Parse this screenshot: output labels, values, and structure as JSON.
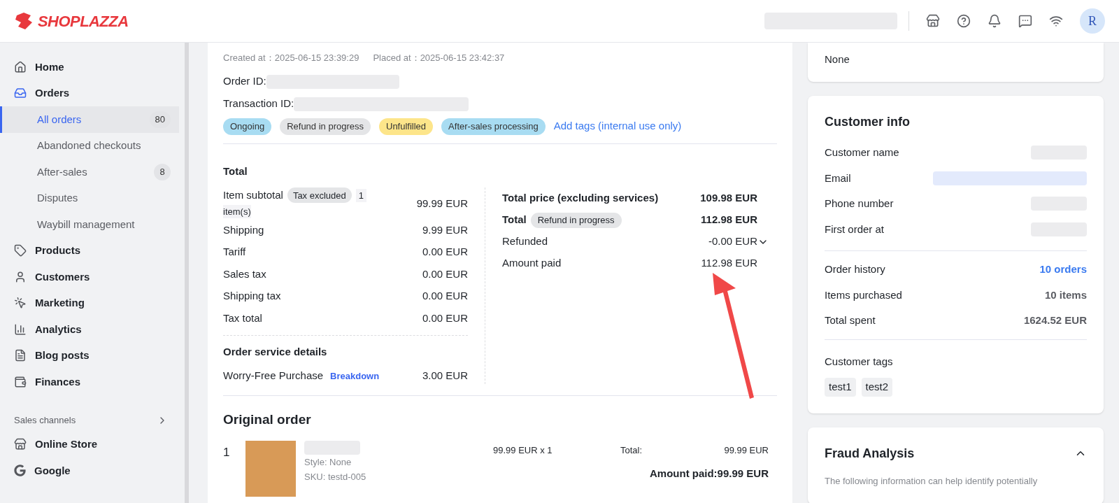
{
  "header": {
    "logo": "SHOPLAZZA",
    "avatar": "R"
  },
  "sidebar": {
    "items": [
      {
        "label": "Home",
        "kind": "nav",
        "selected": false
      },
      {
        "label": "Orders",
        "kind": "nav",
        "selected": false
      },
      {
        "label": "All orders",
        "kind": "sub",
        "selected": true,
        "badge": "80"
      },
      {
        "label": "Abandoned checkouts",
        "kind": "sub",
        "selected": false
      },
      {
        "label": "After-sales",
        "kind": "sub",
        "selected": false,
        "badge": "8"
      },
      {
        "label": "Disputes",
        "kind": "sub",
        "selected": false
      },
      {
        "label": "Waybill management",
        "kind": "sub",
        "selected": false
      },
      {
        "label": "Products",
        "kind": "nav",
        "selected": false
      },
      {
        "label": "Customers",
        "kind": "nav",
        "selected": false
      },
      {
        "label": "Marketing",
        "kind": "nav",
        "selected": false
      },
      {
        "label": "Analytics",
        "kind": "nav",
        "selected": false
      },
      {
        "label": "Blog posts",
        "kind": "nav",
        "selected": false
      },
      {
        "label": "Finances",
        "kind": "nav",
        "selected": false
      }
    ],
    "section_title": "Sales channels",
    "channels": [
      {
        "label": "Online Store"
      },
      {
        "label": "Google"
      }
    ]
  },
  "order": {
    "created_label": "Created at：",
    "created_value": "2025-06-15 23:39:29",
    "placed_label": "Placed at：",
    "placed_value": "2025-06-15 23:42:37",
    "order_id_label": "Order ID:",
    "transaction_id_label": "Transaction ID:",
    "tags": [
      {
        "label": "Ongoing",
        "color": "#a8dcf2"
      },
      {
        "label": "Refund in progress",
        "color": "#e4e5e7"
      },
      {
        "label": "Unfulfilled",
        "color": "#fde58a"
      },
      {
        "label": "After-sales processing",
        "color": "#a8dcf2"
      }
    ],
    "add_tags": "Add tags (internal use only)"
  },
  "total": {
    "title": "Total",
    "subtotal": {
      "label": "Item subtotal",
      "badge": "Tax excluded",
      "count_a": "1",
      "count_b": "item(s)",
      "value": "99.99 EUR"
    },
    "rows": [
      {
        "label": "Shipping",
        "value": "9.99 EUR"
      },
      {
        "label": "Tariff",
        "value": "0.00 EUR"
      },
      {
        "label": "Sales tax",
        "value": "0.00 EUR"
      },
      {
        "label": "Shipping tax",
        "value": "0.00 EUR"
      },
      {
        "label": "Tax total",
        "value": "0.00 EUR"
      }
    ],
    "service_title": "Order service details",
    "service": {
      "label": "Worry-Free Purchase",
      "link": "Breakdown",
      "value": "3.00 EUR"
    },
    "summary": [
      {
        "label": "Total price (excluding services)",
        "value": "109.98 EUR",
        "kind": "bold"
      },
      {
        "label": "Total",
        "badge": "Refund in progress",
        "value": "112.98 EUR",
        "kind": "bold"
      },
      {
        "label": "Refunded",
        "value": "-0.00 EUR",
        "kind": "expandable"
      },
      {
        "label": "Amount paid",
        "value": "112.98 EUR",
        "kind": "plain"
      }
    ]
  },
  "original_order": {
    "title": "Original order",
    "line": {
      "index": "1",
      "style": "Style: None",
      "sku": "SKU: testd-005",
      "price": "99.99 EUR x 1",
      "total_label": "Total:",
      "total_value": "99.99 EUR",
      "paid": "Amount paid:99.99 EUR"
    }
  },
  "notes_card": {
    "value": "None"
  },
  "customer": {
    "title": "Customer info",
    "fields": [
      {
        "label": "Customer name",
        "kind": "grey"
      },
      {
        "label": "Email",
        "kind": "blue"
      },
      {
        "label": "Phone number",
        "kind": "grey"
      },
      {
        "label": "First order at",
        "kind": "grey"
      }
    ],
    "stats": [
      {
        "label": "Order history",
        "value": "10 orders",
        "kind": "link"
      },
      {
        "label": "Items purchased",
        "value": "10 items",
        "kind": "text"
      },
      {
        "label": "Total spent",
        "value": "1624.52 EUR",
        "kind": "text"
      }
    ],
    "tags_label": "Customer tags",
    "tags": [
      "test1",
      "test2"
    ]
  },
  "fraud": {
    "title": "Fraud Analysis",
    "expanded": true,
    "text": "The following information can help identify potentially"
  }
}
